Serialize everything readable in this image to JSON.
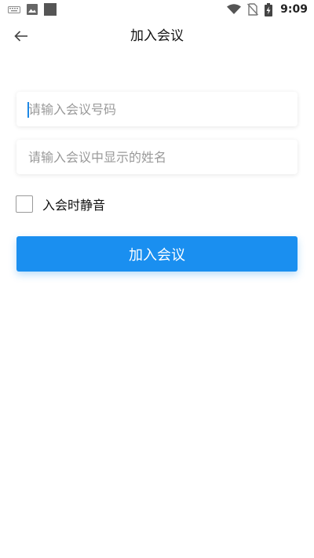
{
  "status_bar": {
    "icons": [
      "keyboard-icon",
      "image-icon",
      "square-icon"
    ],
    "right_icons": [
      "wifi-icon",
      "no-sim-icon",
      "battery-charging-icon"
    ],
    "time": "9:09"
  },
  "header": {
    "back_icon": "arrow-left-icon",
    "title": "加入会议"
  },
  "form": {
    "meeting_id": {
      "value": "",
      "placeholder": "请输入会议号码"
    },
    "display_name": {
      "value": "",
      "placeholder": "请输入会议中显示的姓名"
    },
    "mute_checkbox": {
      "label": "入会时静音",
      "checked": false
    },
    "join_button": {
      "label": "加入会议"
    }
  },
  "colors": {
    "accent": "#1a8ff0",
    "caret": "#1e88e5",
    "placeholder": "#9a9a9a"
  }
}
